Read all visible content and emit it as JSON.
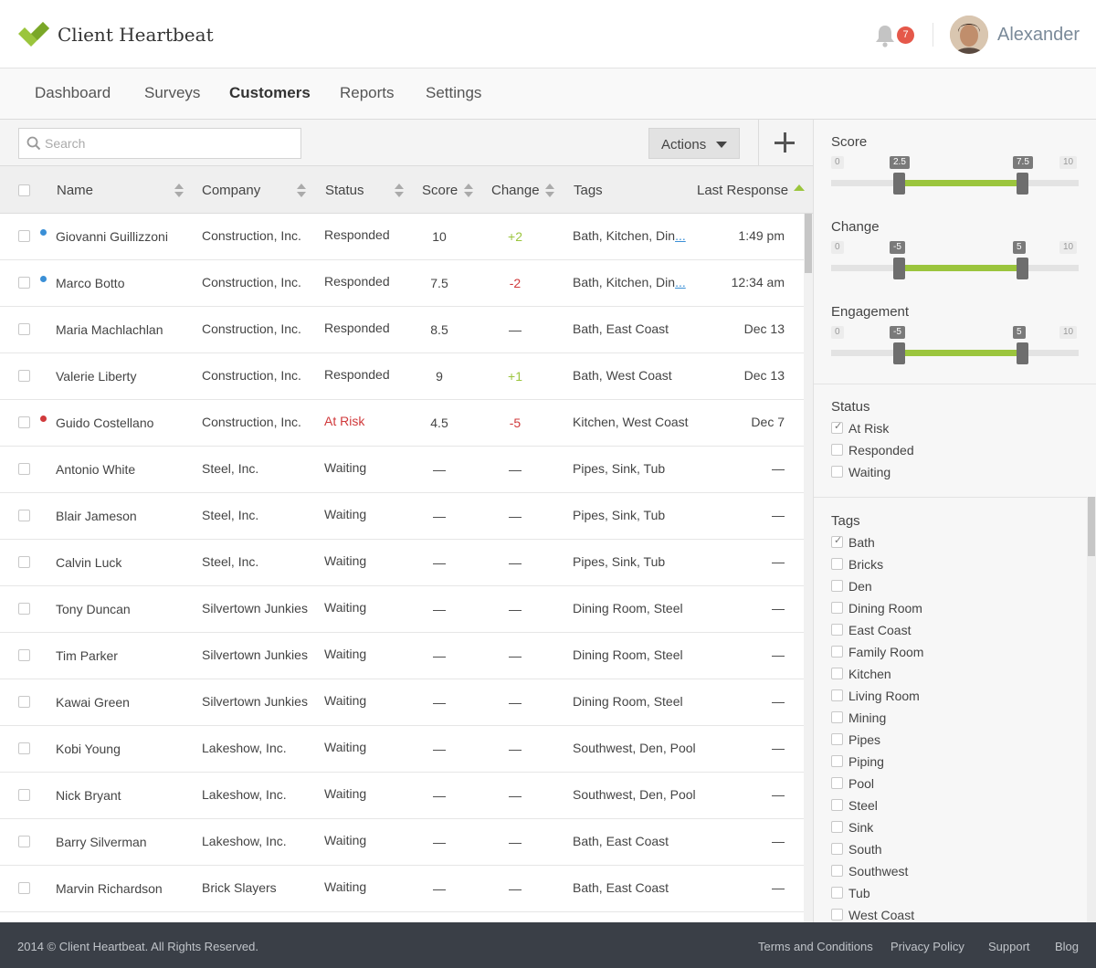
{
  "header": {
    "brand": "Client Heartbeat",
    "notification_count": "7",
    "user_name": "Alexander",
    "icons": {
      "logo": "client-heartbeat-logo",
      "bell": "bell-icon",
      "avatar": "user-avatar"
    }
  },
  "nav": {
    "items": [
      "Dashboard",
      "Surveys",
      "Customers",
      "Reports",
      "Settings"
    ],
    "active": "Customers"
  },
  "toolbar": {
    "search_placeholder": "Search",
    "actions_label": "Actions"
  },
  "table": {
    "columns": {
      "name": "Name",
      "company": "Company",
      "status": "Status",
      "score": "Score",
      "change": "Change",
      "tags": "Tags",
      "last_response": "Last Response"
    },
    "rows": [
      {
        "dot": "blue",
        "name": "Giovanni Guillizzoni",
        "company": "Construction, Inc.",
        "status": "Responded",
        "score": "10",
        "change": "+2",
        "change_color": "green",
        "tags": "Bath, Kitchen, Din",
        "tags_more": "...",
        "last": "1:49 pm"
      },
      {
        "dot": "blue",
        "name": "Marco Botto",
        "company": "Construction, Inc.",
        "status": "Responded",
        "score": "7.5",
        "change": "-2",
        "change_color": "red",
        "tags": "Bath, Kitchen, Din",
        "tags_more": "...",
        "last": "12:34 am"
      },
      {
        "dot": "",
        "name": "Maria Machlachlan",
        "company": "Construction, Inc.",
        "status": "Responded",
        "score": "8.5",
        "change": "—",
        "change_color": "",
        "tags": "Bath, East Coast",
        "tags_more": "",
        "last": "Dec 13"
      },
      {
        "dot": "",
        "name": "Valerie Liberty",
        "company": "Construction, Inc.",
        "status": "Responded",
        "score": "9",
        "change": "+1",
        "change_color": "green",
        "tags": "Bath, West Coast",
        "tags_more": "",
        "last": "Dec 13"
      },
      {
        "dot": "red",
        "name": "Guido Costellano",
        "company": "Construction, Inc.",
        "status": "At Risk",
        "status_color": "red",
        "score": "4.5",
        "change": "-5",
        "change_color": "red",
        "tags": "Kitchen, West Coast",
        "tags_more": "",
        "last": "Dec 7"
      },
      {
        "dot": "",
        "name": "Antonio White",
        "company": "Steel, Inc.",
        "status": "Waiting",
        "score": "—",
        "change": "—",
        "change_color": "",
        "tags": "Pipes, Sink, Tub",
        "tags_more": "",
        "last": "—"
      },
      {
        "dot": "",
        "name": "Blair Jameson",
        "company": "Steel, Inc.",
        "status": "Waiting",
        "score": "—",
        "change": "—",
        "change_color": "",
        "tags": "Pipes, Sink, Tub",
        "tags_more": "",
        "last": "—"
      },
      {
        "dot": "",
        "name": "Calvin Luck",
        "company": "Steel, Inc.",
        "status": "Waiting",
        "score": "—",
        "change": "—",
        "change_color": "",
        "tags": "Pipes, Sink, Tub",
        "tags_more": "",
        "last": "—"
      },
      {
        "dot": "",
        "name": "Tony Duncan",
        "company": "Silvertown Junkies",
        "status": "Waiting",
        "score": "—",
        "change": "—",
        "change_color": "",
        "tags": "Dining Room, Steel",
        "tags_more": "",
        "last": "—"
      },
      {
        "dot": "",
        "name": "Tim Parker",
        "company": "Silvertown Junkies",
        "status": "Waiting",
        "score": "—",
        "change": "—",
        "change_color": "",
        "tags": "Dining Room, Steel",
        "tags_more": "",
        "last": "—"
      },
      {
        "dot": "",
        "name": "Kawai Green",
        "company": "Silvertown Junkies",
        "status": "Waiting",
        "score": "—",
        "change": "—",
        "change_color": "",
        "tags": "Dining Room, Steel",
        "tags_more": "",
        "last": "—"
      },
      {
        "dot": "",
        "name": "Kobi Young",
        "company": "Lakeshow, Inc.",
        "status": "Waiting",
        "score": "—",
        "change": "—",
        "change_color": "",
        "tags": "Southwest, Den, Pool",
        "tags_more": "",
        "last": "—"
      },
      {
        "dot": "",
        "name": "Nick Bryant",
        "company": "Lakeshow, Inc.",
        "status": "Waiting",
        "score": "—",
        "change": "—",
        "change_color": "",
        "tags": "Southwest, Den, Pool",
        "tags_more": "",
        "last": "—"
      },
      {
        "dot": "",
        "name": "Barry Silverman",
        "company": "Lakeshow, Inc.",
        "status": "Waiting",
        "score": "—",
        "change": "—",
        "change_color": "",
        "tags": "Bath, East Coast",
        "tags_more": "",
        "last": "—"
      },
      {
        "dot": "",
        "name": "Marvin Richardson",
        "company": "Brick Slayers",
        "status": "Waiting",
        "score": "—",
        "change": "—",
        "change_color": "",
        "tags": "Bath, East Coast",
        "tags_more": "",
        "last": "—"
      }
    ]
  },
  "filters": {
    "sliders": [
      {
        "label": "Score",
        "min_label": "0",
        "max_label": "10",
        "low_label": "2.5",
        "high_label": "7.5",
        "low_frac": 0.25,
        "high_frac": 0.75
      },
      {
        "label": "Change",
        "min_label": "0",
        "max_label": "10",
        "low_label": "-5",
        "high_label": "5",
        "low_frac": 0.25,
        "high_frac": 0.75
      },
      {
        "label": "Engagement",
        "min_label": "0",
        "max_label": "10",
        "low_label": "-5",
        "high_label": "5",
        "low_frac": 0.25,
        "high_frac": 0.75
      }
    ],
    "status": {
      "title": "Status",
      "options": [
        {
          "label": "At Risk",
          "checked": true
        },
        {
          "label": "Responded",
          "checked": false
        },
        {
          "label": "Waiting",
          "checked": false
        }
      ]
    },
    "tags": {
      "title": "Tags",
      "options": [
        {
          "label": "Bath",
          "checked": true
        },
        {
          "label": "Bricks",
          "checked": false
        },
        {
          "label": "Den",
          "checked": false
        },
        {
          "label": "Dining Room",
          "checked": false
        },
        {
          "label": "East Coast",
          "checked": false
        },
        {
          "label": "Family Room",
          "checked": false
        },
        {
          "label": "Kitchen",
          "checked": false
        },
        {
          "label": "Living Room",
          "checked": false
        },
        {
          "label": "Mining",
          "checked": false
        },
        {
          "label": "Pipes",
          "checked": false
        },
        {
          "label": "Piping",
          "checked": false
        },
        {
          "label": "Pool",
          "checked": false
        },
        {
          "label": "Steel",
          "checked": false
        },
        {
          "label": "Sink",
          "checked": false
        },
        {
          "label": "South",
          "checked": false
        },
        {
          "label": "Southwest",
          "checked": false
        },
        {
          "label": "Tub",
          "checked": false
        },
        {
          "label": "West Coast",
          "checked": false
        }
      ]
    }
  },
  "footer": {
    "copyright": "2014 © Client Heartbeat. All Rights Reserved.",
    "links": [
      "Terms and Conditions",
      "Privacy Policy",
      "Support",
      "Blog"
    ]
  },
  "colors": {
    "accent_green": "#9bc53d",
    "red": "#d0393b",
    "blue": "#3a8fd6",
    "footer_bg": "#3a3f47"
  }
}
